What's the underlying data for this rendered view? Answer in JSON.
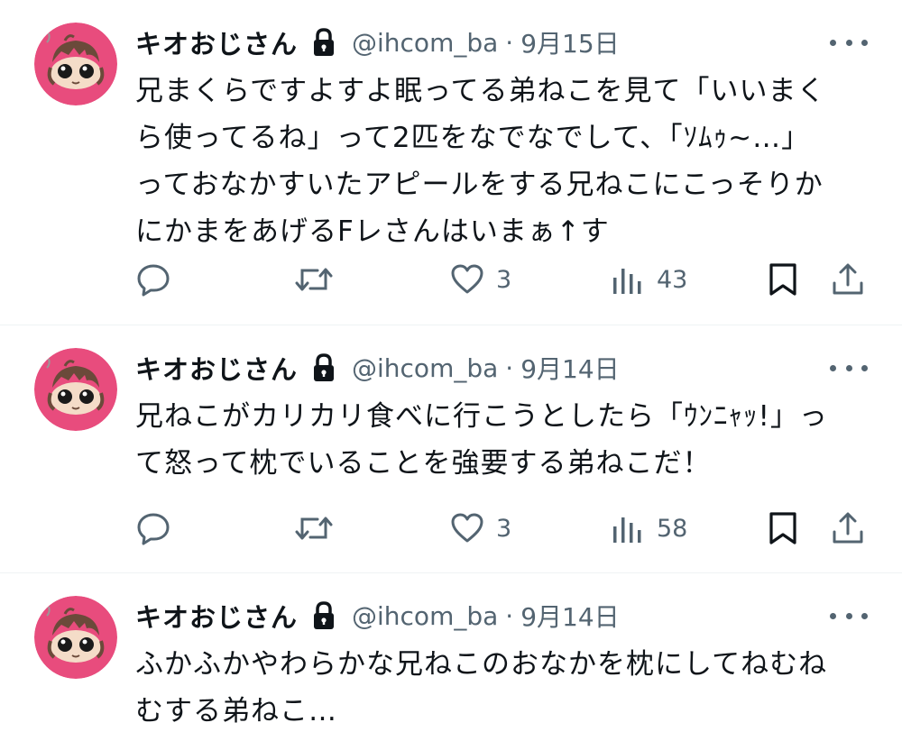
{
  "colors": {
    "text_primary": "#0f1419",
    "text_secondary": "#536471",
    "avatar_background": "#e84c7d",
    "divider": "#eff3f4"
  },
  "icons": {
    "account": "lock-icon",
    "menu": "more-horizontal-icon",
    "reply": "reply-icon",
    "retweet": "retweet-icon",
    "like": "heart-icon",
    "views": "views-chart-icon",
    "bookmark": "bookmark-icon",
    "share": "share-icon"
  },
  "tweets": [
    {
      "author": {
        "name": "キオおじさん",
        "handle": "@ihcom_ba"
      },
      "separator": "·",
      "date": "9月15日",
      "lines": [
        "兄まくらですよすよ眠ってる弟ねこを見て「いいまく",
        "ら使ってるね」って2匹をなでなでして、「ｿﾑｩ~…」",
        "っておなかすいたアピールをする兄ねこにこっそりか",
        "にかまをあげるFレさんはいまぁ↑す"
      ],
      "stats": {
        "likes": "3",
        "views": "43"
      }
    },
    {
      "author": {
        "name": "キオおじさん",
        "handle": "@ihcom_ba"
      },
      "separator": "·",
      "date": "9月14日",
      "lines": [
        "兄ねこがカリカリ食べに行こうとしたら「ｳﾝﾆｬｯ!」っ",
        "て怒って枕でいることを強要する弟ねこだ！"
      ],
      "stats": {
        "likes": "3",
        "views": "58"
      }
    },
    {
      "author": {
        "name": "キオおじさん",
        "handle": "@ihcom_ba"
      },
      "separator": "·",
      "date": "9月14日",
      "lines": [
        "ふかふかやわらかな兄ねこのおなかを枕にしてねむね",
        "むする弟ねこ…"
      ]
    }
  ]
}
